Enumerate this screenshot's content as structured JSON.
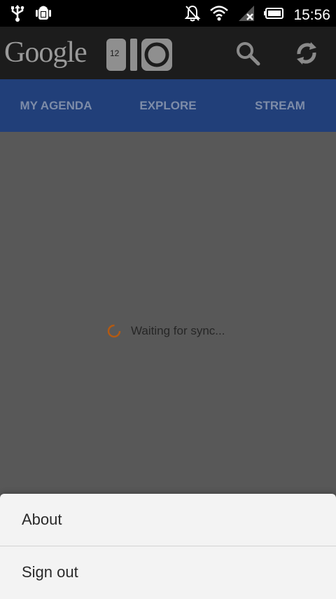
{
  "status_bar": {
    "time": "15:56",
    "icons": [
      "usb-icon",
      "android-debug-icon",
      "notifications-off-icon",
      "wifi-icon",
      "signal-no-sim-icon",
      "battery-icon"
    ]
  },
  "action_bar": {
    "brand": "Google",
    "io_badge": "12",
    "icons": [
      "search-icon",
      "refresh-icon"
    ]
  },
  "tabs": [
    {
      "label": "MY AGENDA"
    },
    {
      "label": "EXPLORE"
    },
    {
      "label": "STREAM"
    }
  ],
  "content": {
    "waiting_text": "Waiting for sync..."
  },
  "menu": {
    "items": [
      {
        "label": "About"
      },
      {
        "label": "Sign out"
      }
    ]
  },
  "colors": {
    "status_bar": "#000000",
    "action_bar": "#1c1c1c",
    "tab_bar": "#213f79",
    "tab_text": "#7d8ca8",
    "content_dim": "#585858",
    "menu_bg": "#f3f3f3",
    "spinner": "#b35a12"
  }
}
